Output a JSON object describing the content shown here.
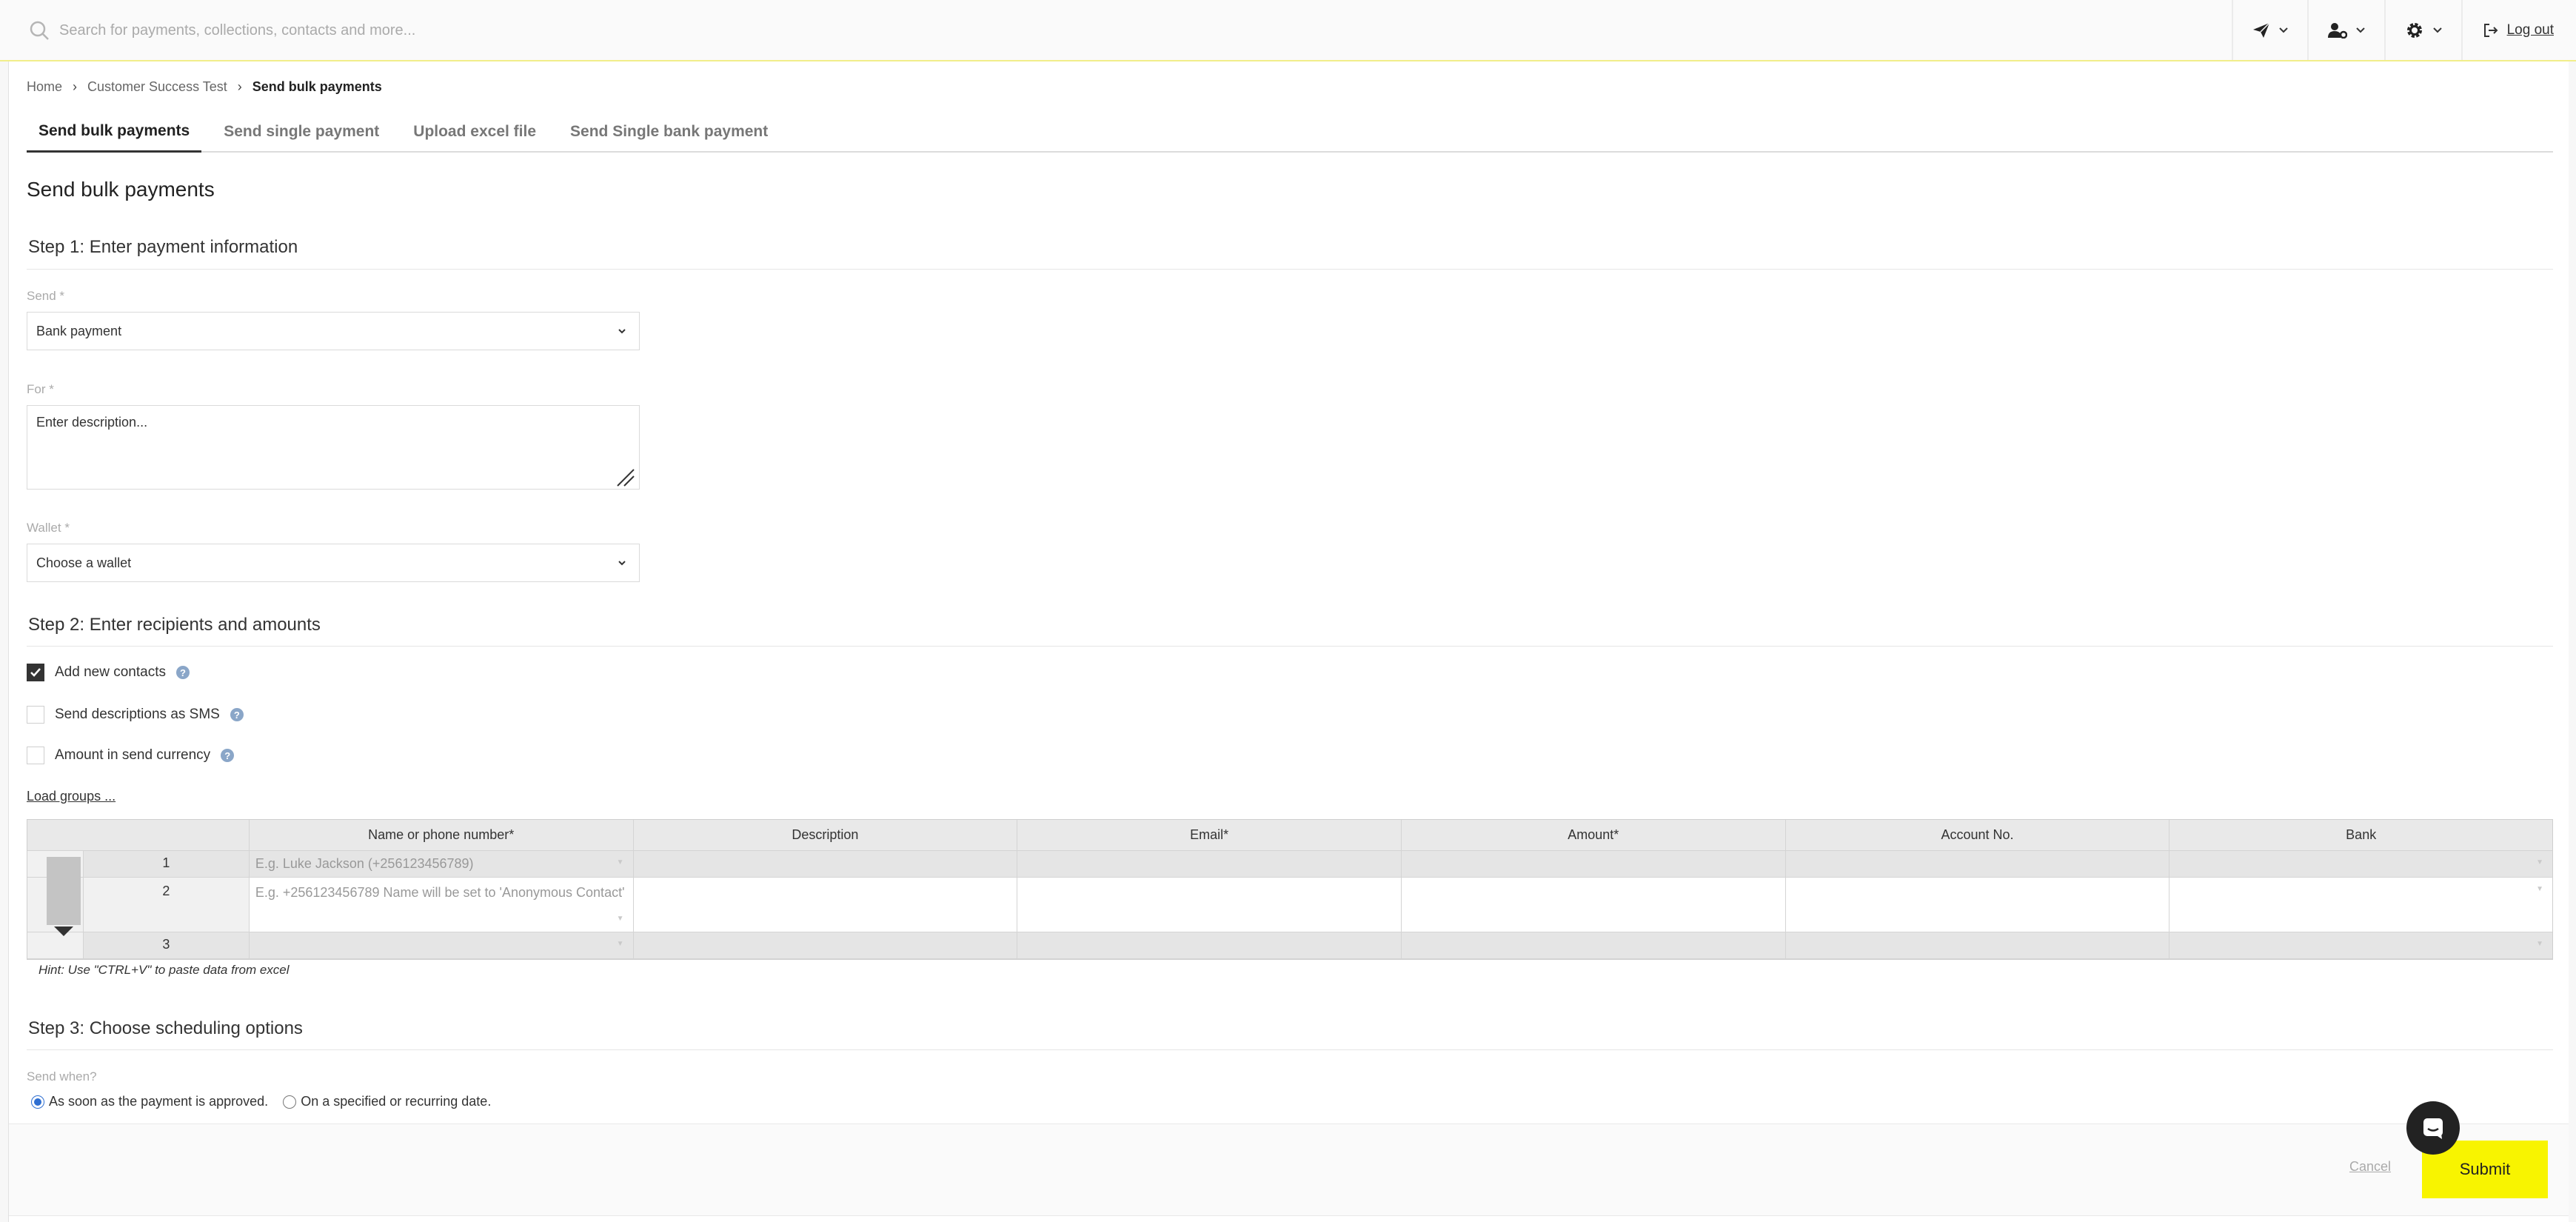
{
  "search": {
    "placeholder": "Search for payments, collections, contacts and more..."
  },
  "topbar": {
    "logout_label": "Log out"
  },
  "breadcrumb": {
    "home": "Home",
    "parent": "Customer Success Test",
    "current": "Send bulk payments"
  },
  "tabs": [
    {
      "label": "Send bulk payments"
    },
    {
      "label": "Send single payment"
    },
    {
      "label": "Upload excel file"
    },
    {
      "label": "Send Single bank payment"
    }
  ],
  "page": {
    "title": "Send bulk payments"
  },
  "step1": {
    "title": "Step 1: Enter payment information",
    "send_label": "Send *",
    "send_value": "Bank payment",
    "for_label": "For *",
    "for_placeholder": "Enter description...",
    "wallet_label": "Wallet *",
    "wallet_value": "Choose a wallet"
  },
  "step2": {
    "title": "Step 2: Enter recipients and amounts",
    "options": [
      {
        "label": "Add new contacts",
        "checked": true
      },
      {
        "label": "Send descriptions as SMS",
        "checked": false
      },
      {
        "label": "Amount in send currency",
        "checked": false
      }
    ],
    "load_groups": "Load groups ...",
    "columns": [
      "Name or phone number*",
      "Description",
      "Email*",
      "Amount*",
      "Account No.",
      "Bank"
    ],
    "rows": [
      {
        "num": "1",
        "name_placeholder": "E.g. Luke Jackson (+256123456789)"
      },
      {
        "num": "2",
        "name_placeholder": "E.g. +256123456789 Name will be set to 'Anonymous Contact'"
      },
      {
        "num": "3",
        "name_placeholder": ""
      }
    ],
    "hint": "Hint: Use \"CTRL+V\" to paste data from excel"
  },
  "step3": {
    "title": "Step 3: Choose scheduling options",
    "send_when_label": "Send when?",
    "option_asap": "As soon as the payment is approved.",
    "option_scheduled": "On a specified or recurring date."
  },
  "footer": {
    "cancel_label": "Cancel",
    "submit_label": "Submit"
  }
}
